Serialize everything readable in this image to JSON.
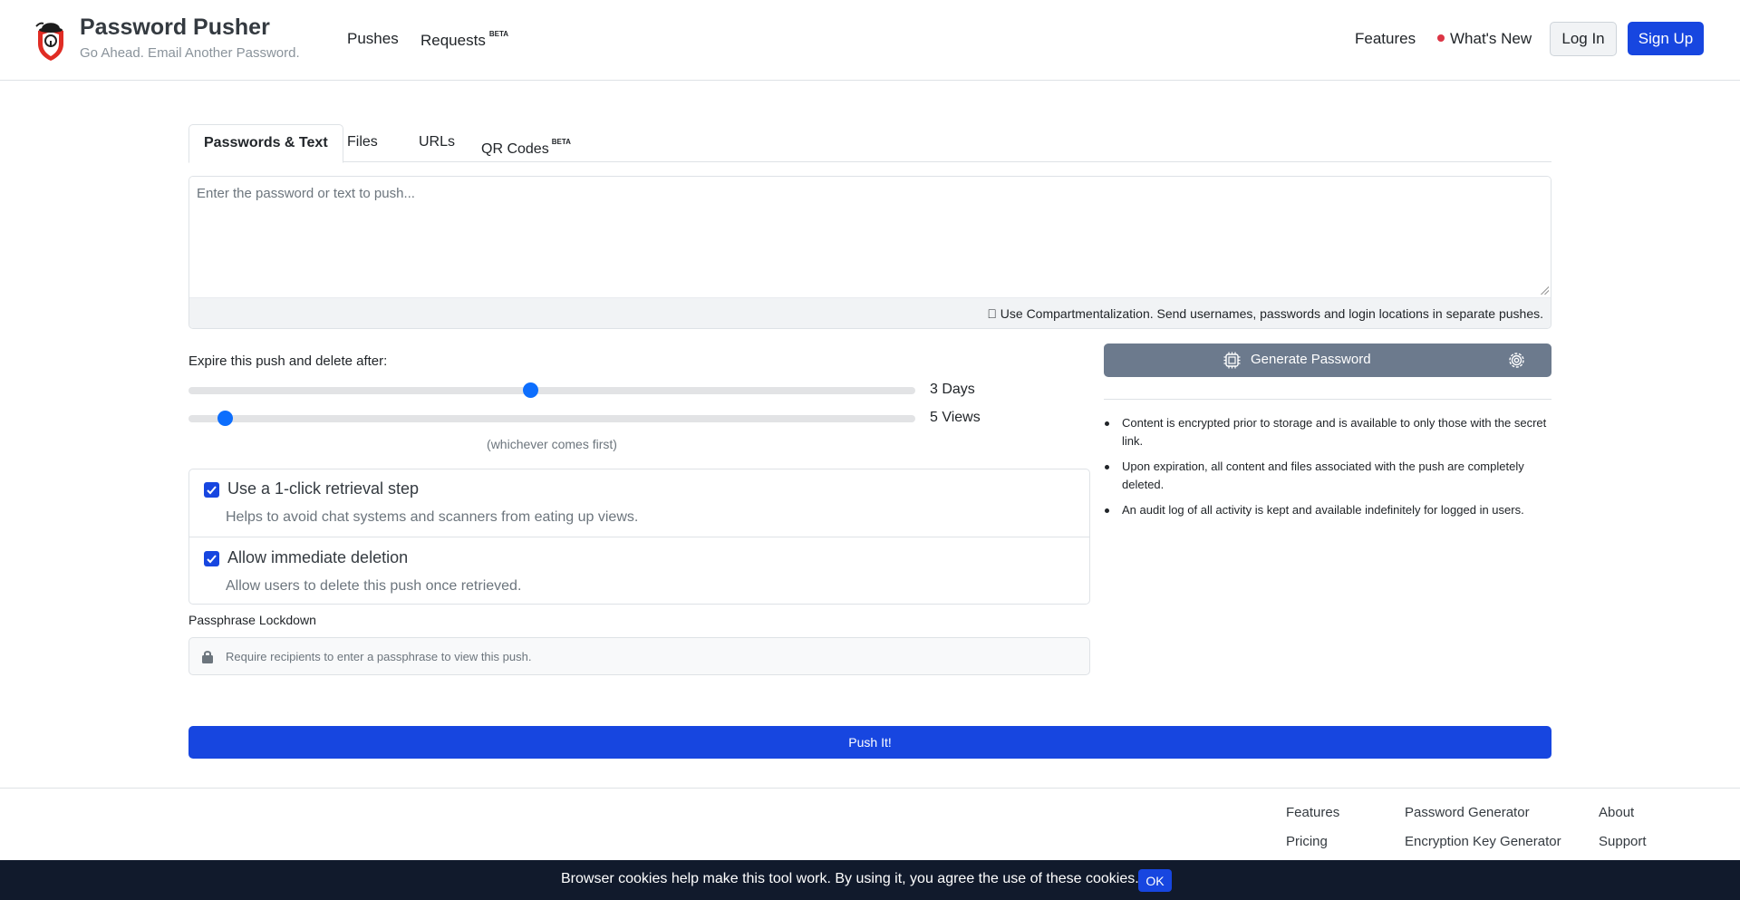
{
  "header": {
    "logo_icon": "bowler-hat-lock-shield-logo",
    "brand_title": "Password Pusher",
    "tagline": "Go Ahead. Email Another Password.",
    "nav_left": [
      {
        "label": "Pushes"
      },
      {
        "label": "Requests",
        "badge": "BETA"
      }
    ],
    "nav_right": [
      {
        "label": "Features"
      },
      {
        "label": "What's New"
      }
    ],
    "login_label": "Log In",
    "signup_label": "Sign Up"
  },
  "tabs": [
    {
      "label": "Passwords & Text",
      "active": true
    },
    {
      "label": "Files"
    },
    {
      "label": "URLs"
    },
    {
      "label": "QR Codes",
      "badge": "BETA"
    }
  ],
  "payload": {
    "placeholder": "Enter the password or text to push...",
    "value": "",
    "hint": "\u0000 Use Compartmentalization. Send usernames, passwords and login locations in separate pushes."
  },
  "expiration": {
    "label": "Expire this push and delete after:",
    "days_value": 3,
    "days_label": "3 Days",
    "days_fraction": 0.47,
    "views_value": 5,
    "views_label": "5 Views",
    "views_fraction": 0.05,
    "note": "(whichever comes first)"
  },
  "options": [
    {
      "checked": true,
      "title": "Use a 1-click retrieval step",
      "desc": "Helps to avoid chat systems and scanners from eating up views."
    },
    {
      "checked": true,
      "title": "Allow immediate deletion",
      "desc": "Allow users to delete this push once retrieved."
    }
  ],
  "passphrase": {
    "label": "Passphrase Lockdown",
    "placeholder": "Require recipients to enter a passphrase to view this push."
  },
  "generator": {
    "label": "Generate Password",
    "icon_left": "cpu-chip-icon",
    "icon_right": "gear-icon"
  },
  "info": [
    "Content is encrypted prior to storage and is available to only those with the secret link.",
    "Upon expiration, all content and files associated with the push are completely deleted.",
    "An audit log of all activity is kept and available indefinitely for logged in users."
  ],
  "push_label": "Push It!",
  "footer": {
    "col1": [
      "Features",
      "Pricing"
    ],
    "col2": [
      "Password Generator",
      "Encryption Key Generator"
    ],
    "col3": [
      "About",
      "Support"
    ]
  },
  "cookie": {
    "text": "Browser cookies help make this tool work. By using it, you agree the use of these cookies.",
    "ok_label": "OK"
  },
  "colors": {
    "primary": "#1746e0",
    "secondary": "#6c7a8d",
    "cookie_bg": "#111a2c",
    "slider": "#0d6efd",
    "new_dot": "#dc3545"
  }
}
